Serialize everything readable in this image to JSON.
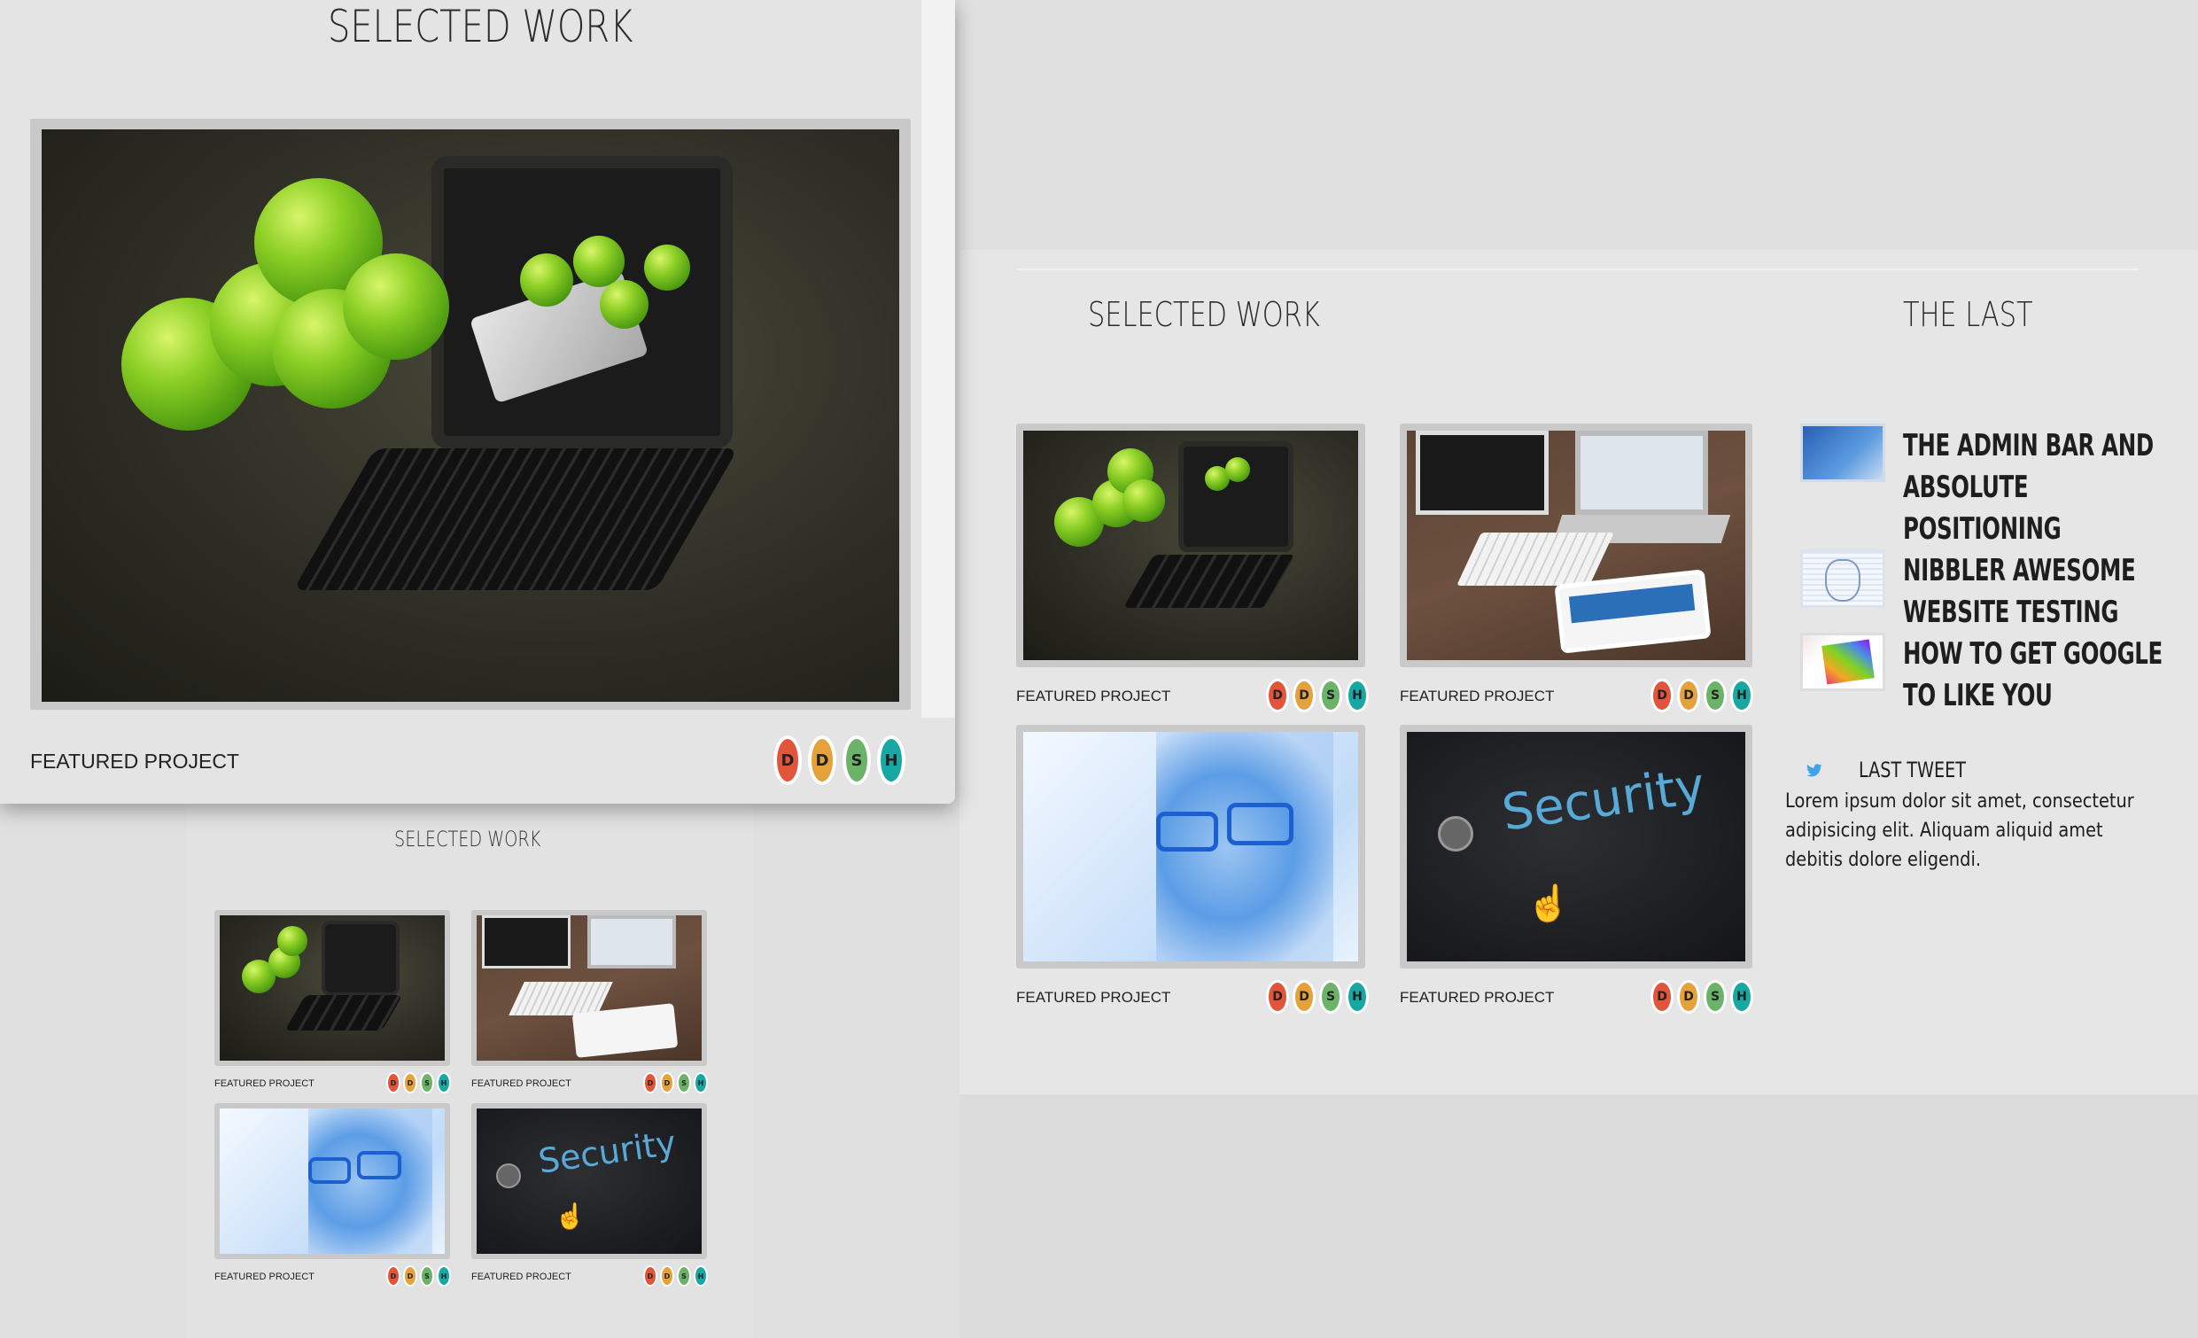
{
  "preview_large": {
    "title": "SELECTED WORK",
    "caption": "FEATURED PROJECT",
    "badges": [
      "D",
      "D",
      "S",
      "H"
    ]
  },
  "preview_small": {
    "title": "SELECTED WORK",
    "items": [
      {
        "caption": "FEATURED PROJECT",
        "image": "apples-tablet"
      },
      {
        "caption": "FEATURED PROJECT",
        "image": "desk-computers"
      },
      {
        "caption": "FEATURED PROJECT",
        "image": "binary-face"
      },
      {
        "caption": "FEATURED PROJECT",
        "image": "security-screen"
      }
    ]
  },
  "main": {
    "section_title": "SELECTED WORK",
    "items": [
      {
        "caption": "FEATURED PROJECT",
        "image": "apples-tablet"
      },
      {
        "caption": "FEATURED PROJECT",
        "image": "desk-computers"
      },
      {
        "caption": "FEATURED PROJECT",
        "image": "binary-face"
      },
      {
        "caption": "FEATURED PROJECT",
        "image": "security-screen"
      }
    ],
    "security_word": "Security"
  },
  "sidebar": {
    "title": "THE LAST",
    "posts": [
      "THE ADMIN BAR AND ABSOLUTE POSITIONING",
      "NIBBLER AWESOME WEBSITE TESTING",
      "HOW TO GET GOOGLE TO LIKE YOU"
    ],
    "post_lines": [
      "THE ADMIN BAR AND",
      "ABSOLUTE",
      "POSITIONING",
      "NIBBLER AWESOME",
      "WEBSITE TESTING",
      "HOW TO GET GOOGLE",
      "TO LIKE YOU"
    ],
    "tweet_heading": "LAST TWEET",
    "tweet_lines": [
      "Lorem ipsum dolor sit amet, consectetur",
      "adipisicing elit. Aliquam aliquid amet",
      "debitis dolore eligendi."
    ]
  },
  "badge_labels": [
    "D",
    "D",
    "S",
    "H"
  ],
  "colors": {
    "badge_d1": "#e2553a",
    "badge_d2": "#e5a23a",
    "badge_s": "#6cb36a",
    "badge_h": "#17a8a3",
    "twitter": "#3ea6e6"
  }
}
